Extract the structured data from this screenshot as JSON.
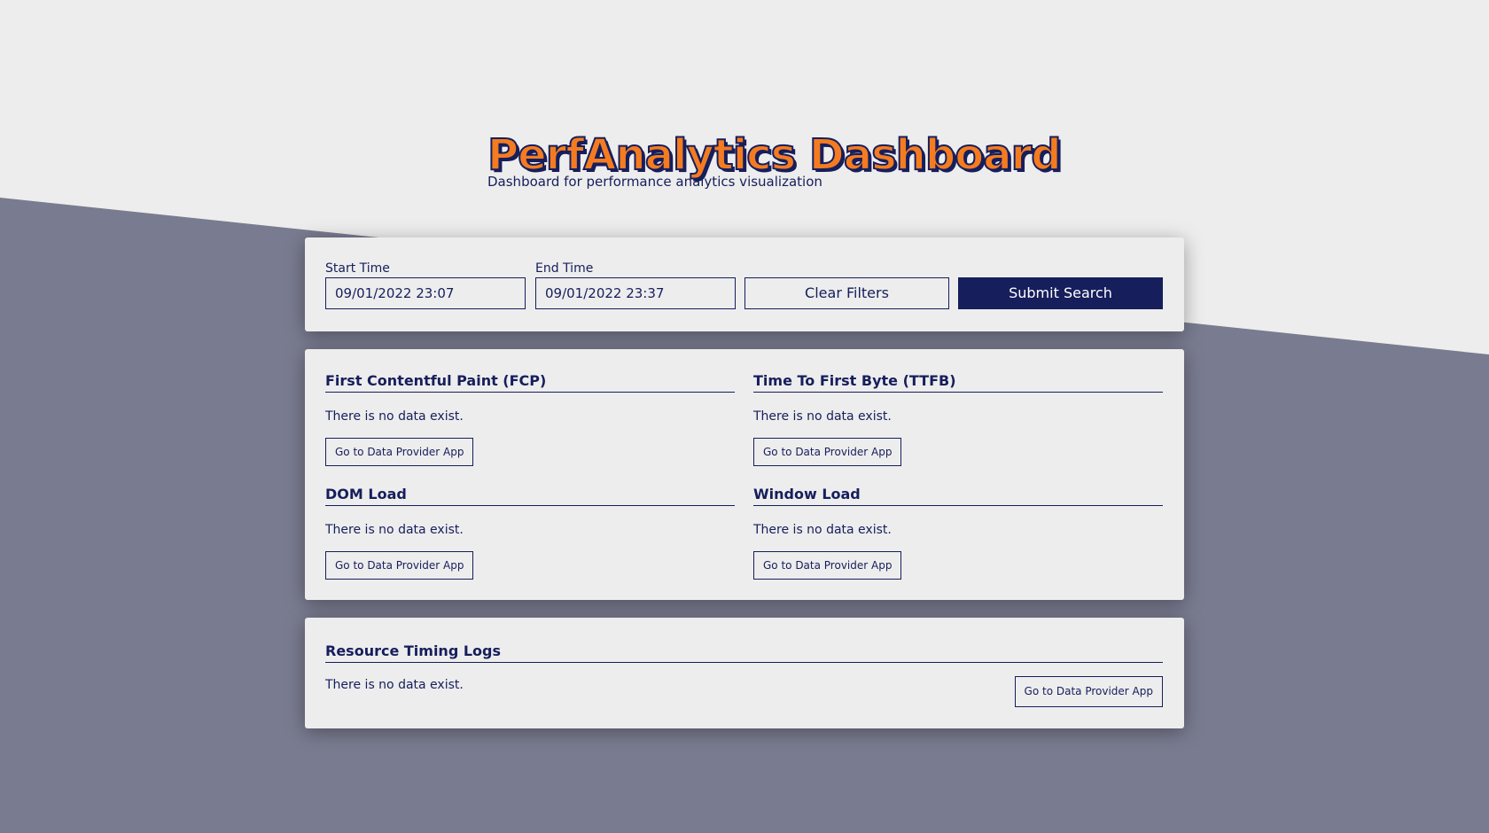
{
  "header": {
    "title": "PerfAnalytics Dashboard",
    "subtitle": "Dashboard for performance analytics visualization"
  },
  "filters": {
    "start_label": "Start Time",
    "start_value": "09/01/2022 23:07",
    "end_label": "End Time",
    "end_value": "09/01/2022 23:37",
    "clear_label": "Clear Filters",
    "submit_label": "Submit Search"
  },
  "metrics": [
    {
      "title": "First Contentful Paint (FCP)",
      "empty": "There is no data exist.",
      "button": "Go to Data Provider App"
    },
    {
      "title": "Time To First Byte (TTFB)",
      "empty": "There is no data exist.",
      "button": "Go to Data Provider App"
    },
    {
      "title": "DOM Load",
      "empty": "There is no data exist.",
      "button": "Go to Data Provider App"
    },
    {
      "title": "Window Load",
      "empty": "There is no data exist.",
      "button": "Go to Data Provider App"
    }
  ],
  "logs": {
    "title": "Resource Timing Logs",
    "empty": "There is no data exist.",
    "button": "Go to Data Provider App"
  },
  "colors": {
    "primary": "#161e5c",
    "accent": "#f47b20",
    "background": "#ededed",
    "slant": "#797b90"
  }
}
